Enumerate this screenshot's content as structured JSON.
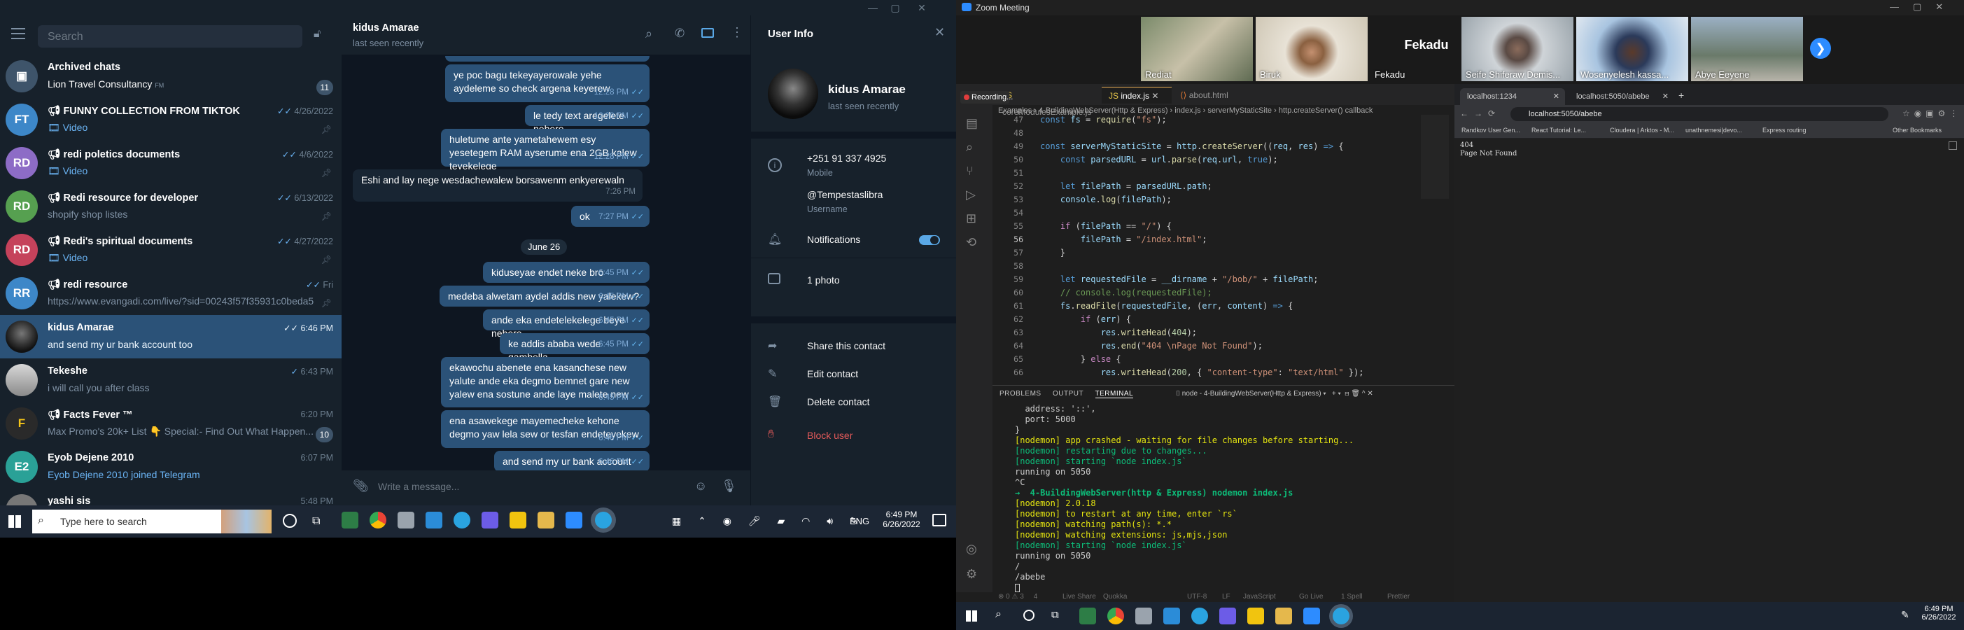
{
  "telegram": {
    "search_placeholder": "Search",
    "chats": [
      {
        "title": "Archived chats",
        "preview": "Lion Travel Consultancy",
        "preview_suffix": "FM",
        "date": "",
        "badge": "11",
        "avatar_text": "",
        "avatar_color": "#3e546a"
      },
      {
        "title": "FUNNY COLLECTION FROM TIKTOK",
        "preview": "Video",
        "date": "4/26/2022",
        "badge": "",
        "avatar_text": "FT",
        "avatar_color": "#3d87c8"
      },
      {
        "title": "redi poletics documents",
        "preview": "Video",
        "date": "4/6/2022",
        "badge": "",
        "avatar_text": "RD",
        "avatar_color": "#8d6cc6"
      },
      {
        "title": "Redi resource for developer",
        "preview": "shopify shop listes",
        "date": "6/13/2022",
        "badge": "",
        "avatar_text": "RD",
        "avatar_color": "#56a050"
      },
      {
        "title": "Redi's spiritual documents",
        "preview": "Video",
        "date": "4/27/2022",
        "badge": "",
        "avatar_text": "RD",
        "avatar_color": "#c5425b"
      },
      {
        "title": "redi resource",
        "preview": "https://www.evangadi.com/live/?sid=00243f57f35931c0beda5...",
        "date": "Fri",
        "badge": "",
        "avatar_text": "RR",
        "avatar_color": "#3d87c8"
      },
      {
        "title": "kidus Amarae",
        "preview": "and send my ur bank account too",
        "date": "6:46 PM",
        "badge": "",
        "avatar_text": "",
        "avatar_color": "#222"
      },
      {
        "title": "Tekeshe",
        "preview": "i will call you after class",
        "date": "6:43 PM",
        "badge": "",
        "avatar_text": "",
        "avatar_color": "#b9b9b9"
      },
      {
        "title": "Facts Fever ™",
        "preview": "Max Promo's 20k+ List 👇 Special:- Find Out What Happen...",
        "date": "6:20 PM",
        "badge": "10",
        "avatar_text": "",
        "avatar_color": "#2a2a2a"
      },
      {
        "title": "Eyob Dejene 2010",
        "preview": "Eyob Dejene 2010 joined Telegram",
        "date": "6:07 PM",
        "badge": "",
        "avatar_text": "E2",
        "avatar_color": "#2aa197"
      },
      {
        "title": "yashi sis",
        "preview": "",
        "date": "5:48 PM",
        "badge": "",
        "avatar_text": "",
        "avatar_color": "#777"
      }
    ],
    "chat_header": {
      "name": "kidus Amarae",
      "status": "last seen recently"
    },
    "messages": [
      {
        "dir": "out",
        "text": "ye poc bagu tekeyayerowale yehe aydeleme so check argena keyerew",
        "time": "12:28 PM"
      },
      {
        "dir": "out",
        "text": "le tedy text aregelete nebere",
        "time": "12:28 PM"
      },
      {
        "dir": "out",
        "text": "huletume ante yametahewem esy yesetegem RAM ayserume ena 2GB kalew teyekelege",
        "time": "12:28 PM"
      },
      {
        "dir": "in",
        "text": "Eshi and lay nege wesdachewalew borsawenm enkyerewaln",
        "time": "7:26 PM"
      },
      {
        "dir": "out",
        "text": "ok",
        "time": "7:27 PM"
      },
      {
        "dir": "out",
        "text": "kiduseyae endet neke bro",
        "time": "6:45 PM"
      },
      {
        "dir": "out",
        "text": "medeba alwetam aydel addis new yalekew?",
        "time": "6:45 PM"
      },
      {
        "dir": "out",
        "text": "ande eka endetelekelege beye nebere",
        "time": "6:45 PM"
      },
      {
        "dir": "out",
        "text": "ke addis ababa wede gambella",
        "time": "6:45 PM"
      },
      {
        "dir": "out",
        "text": "ekawochu abenete ena kasanchese new yalute ande eka degmo bemnet gare new yalew ena sostune ande laye malete new",
        "time": "6:45 PM"
      },
      {
        "dir": "out",
        "text": "ena asawekege mayemecheke kehone degmo yaw lela sew or tesfan endeteyekew",
        "time": "6:46 PM"
      },
      {
        "dir": "out",
        "text": "and send my ur bank account too",
        "time": "6:46 PM"
      }
    ],
    "date_separator": "June 26",
    "composer_placeholder": "Write a message...",
    "user_info": {
      "title": "User Info",
      "name": "kidus Amarae",
      "status": "last seen recently",
      "phone": "+251 91 337 4925",
      "phone_label": "Mobile",
      "username": "@Tempestaslibra",
      "username_label": "Username",
      "notifications": "Notifications",
      "photos": "1 photo",
      "share": "Share this contact",
      "edit": "Edit contact",
      "delete": "Delete contact",
      "block": "Block user"
    },
    "taskbar": {
      "search": "Type here to search",
      "lang": "ENG",
      "time": "6:49 PM",
      "date": "6/26/2022"
    }
  },
  "zoom": {
    "window_title": "Zoom Meeting",
    "participants": [
      "Rediat",
      "Biruk",
      "Fekadu",
      "Seife Shiferaw Demis...",
      "Wosenyelesh kassa...",
      "Abye Eeyene"
    ],
    "participant_name_tile": "Fekadu",
    "recording": "Recording..."
  },
  "vscode": {
    "tabs": [
      "coreModulesExample.js",
      "index.js",
      "about.html"
    ],
    "breadcrumb": [
      "Examples",
      "4-BuildingWebServer(Http & Express)",
      "index.js",
      "serverMyStaticSite",
      "http.createServer() callback"
    ],
    "line_numbers": [
      "47",
      "48",
      "49",
      "50",
      "51",
      "52",
      "53",
      "54",
      "55",
      "56",
      "57",
      "58",
      "59",
      "60",
      "61",
      "62",
      "63",
      "64",
      "65",
      "66"
    ],
    "panel_tabs": [
      "PROBLEMS",
      "OUTPUT",
      "TERMINAL"
    ],
    "terminal_name": "node - 4-BuildingWebServer(Http & Express)",
    "terminal_lines": [
      "  address: '::',",
      "  port: 5000",
      "}",
      "[nodemon] app crashed - waiting for file changes before starting...",
      "[nodemon] restarting due to changes...",
      "[nodemon] starting `node index.js`",
      "running on 5050",
      "^C",
      "→  4-BuildingWebServer(http & Express) nodemon index.js",
      "[nodemon] 2.0.18",
      "[nodemon] to restart at any time, enter `rs`",
      "[nodemon] watching path(s): *.*",
      "[nodemon] watching extensions: js,mjs,json",
      "[nodemon] starting `node index.js`",
      "running on 5050",
      "/",
      "/abebe"
    ],
    "status_items": [
      "Live Share",
      "Quokka",
      "UTF-8",
      "LF",
      "JavaScript",
      "Go Live",
      "1 Spell",
      "Prettier"
    ]
  },
  "browser": {
    "tabs": [
      "localhost:1234",
      "localhost:5050/abebe"
    ],
    "url": "localhost:5050/abebe",
    "bookmarks": [
      "Randkov User Gen...",
      "React Tutorial: Le...",
      "Cloudera | Arktos - M...",
      "unathnemesi|devo...",
      "Express routing",
      "Other Bookmarks"
    ],
    "page_lines": [
      "404",
      "Page Not Found"
    ]
  },
  "win_taskbar_right": {
    "time": "6:49 PM",
    "date": "6/26/2022"
  }
}
